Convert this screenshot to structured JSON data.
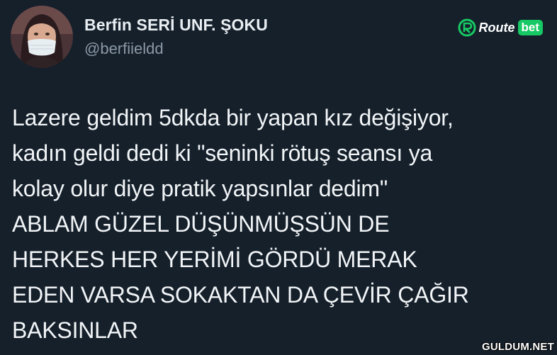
{
  "author": {
    "display_name": "Berfin SERİ UNF. ŞOKU",
    "handle": "@berfiieldd",
    "avatar": "profile-photo-woman-face-mask"
  },
  "brand": {
    "icon": "routebet-r-logo",
    "route_label": "Route",
    "bet_label": "bet",
    "accent_color": "#17c964"
  },
  "tweet": {
    "lines": [
      "Lazere geldim 5dkda bir yapan kız değişiyor,",
      "kadın geldi dedi ki \"seninki rötuş seansı ya",
      "kolay olur diye pratik yapsınlar dedim\"",
      "ABLAM GÜZEL DÜŞÜNMÜŞSÜN DE",
      "HERKES HER YERİMİ GÖRDÜ MERAK",
      "EDEN VARSA SOKAKTAN DA ÇEVİR ÇAĞIR",
      "BAKSINLAR"
    ]
  },
  "watermark": "GULDUM.NET",
  "colors": {
    "background": "#15202b",
    "text": "#f2f5f7",
    "handle": "#8b98a5"
  }
}
